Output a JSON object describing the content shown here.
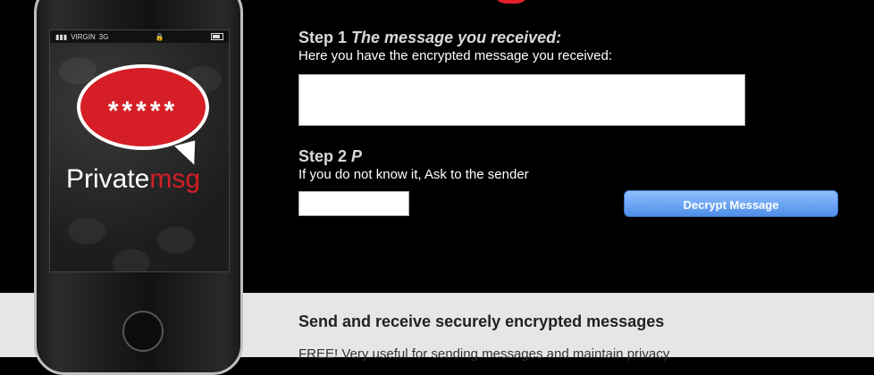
{
  "phone": {
    "carrier": "VIRGIN",
    "network": "3G",
    "logo_stars": "*****",
    "logo_word_private": "Private",
    "logo_word_msg": "msg"
  },
  "step1": {
    "label": "Step 1",
    "title": "The message you received:",
    "description": "Here you have the encrypted message you received:",
    "message_value": ""
  },
  "step2": {
    "label": "Step 2",
    "title": "P",
    "description": "If you do not know it, Ask to the sender",
    "password_value": ""
  },
  "actions": {
    "decrypt_label": "Decrypt Message"
  },
  "promo": {
    "title": "Send and receive securely encrypted messages",
    "description": "FREE! Very useful for sending messages and maintain privacy"
  },
  "colors": {
    "brand_red": "#d51e25",
    "button_blue": "#4f8ee8"
  }
}
